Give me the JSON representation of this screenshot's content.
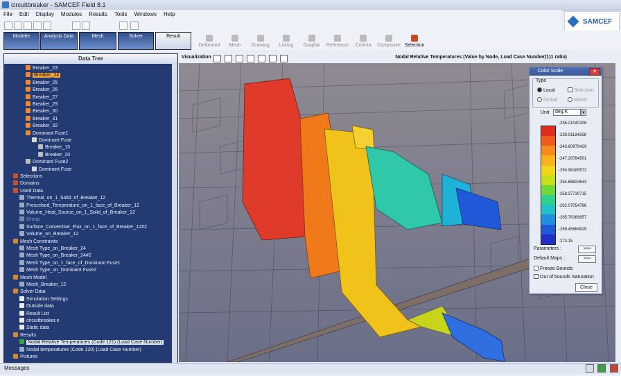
{
  "window": {
    "title": "circuitbreaker - SAMCEF Field 8.1"
  },
  "menu": [
    "File",
    "Edit",
    "Display",
    "Modules",
    "Results",
    "Tools",
    "Windows",
    "Help"
  ],
  "brand": "SAMCEF",
  "modules": [
    {
      "label": "Modeler"
    },
    {
      "label": "Analysis Data"
    },
    {
      "label": "Mesh"
    },
    {
      "label": "Solver"
    },
    {
      "label": "Result",
      "active": true
    }
  ],
  "result_tools": [
    "Deformed",
    "Mesh",
    "Drawing",
    "Listing",
    "Graphic",
    "Reference",
    "Criteria",
    "Composite",
    "Selection"
  ],
  "tree": {
    "header": "Data Tree",
    "items": [
      {
        "label": "Breaker_23",
        "indent": 3,
        "color": "#f08a2a"
      },
      {
        "label": "Breaker_24",
        "indent": 3,
        "color": "#f08a2a",
        "selected": true
      },
      {
        "label": "Breaker_25",
        "indent": 3,
        "color": "#f08a2a"
      },
      {
        "label": "Breaker_26",
        "indent": 3,
        "color": "#f08a2a"
      },
      {
        "label": "Breaker_27",
        "indent": 3,
        "color": "#f08a2a"
      },
      {
        "label": "Breaker_29",
        "indent": 3,
        "color": "#f08a2a"
      },
      {
        "label": "Breaker_30",
        "indent": 3,
        "color": "#f08a2a"
      },
      {
        "label": "Breaker_31",
        "indent": 3,
        "color": "#f08a2a"
      },
      {
        "label": "Breaker_32",
        "indent": 3,
        "color": "#f08a2a"
      },
      {
        "label": "Dominant Fuse1",
        "indent": 3,
        "color": "#f08a2a"
      },
      {
        "label": "Dominant Fuse",
        "indent": 4,
        "color": "#d8d8d8"
      },
      {
        "label": "Breaker_15",
        "indent": 5,
        "color": "#bcbcbc"
      },
      {
        "label": "Breaker_20",
        "indent": 5,
        "color": "#bcbcbc"
      },
      {
        "label": "Dominant Fuse2",
        "indent": 3,
        "color": "#bcbcbc"
      },
      {
        "label": "Dominant Fuse",
        "indent": 4,
        "color": "#d8d8d8"
      },
      {
        "label": "Selections",
        "indent": 1,
        "color": "#c8502a"
      },
      {
        "label": "Domains",
        "indent": 1,
        "color": "#c8502a"
      },
      {
        "label": "Used Data",
        "indent": 1,
        "color": "#c8502a"
      },
      {
        "label": "Thermal_on_1_Solid_of_Breaker_12",
        "indent": 2,
        "color": "#9aa9c4"
      },
      {
        "label": "Prescribed_Temperature_on_1_face_of_Breaker_12",
        "indent": 2,
        "color": "#9aa9c4"
      },
      {
        "label": "Volume_Heat_Source_on_1_Solid_of_Breaker_12",
        "indent": 2,
        "color": "#9aa9c4"
      },
      {
        "label": "Group",
        "indent": 2,
        "color": "#7a8aa8",
        "dim": true
      },
      {
        "label": "Surface_Convective_Flux_on_1_face_of_Breaker_12#2",
        "indent": 2,
        "color": "#9aa9c4"
      },
      {
        "label": "Volume_on_Breaker_12",
        "indent": 2,
        "color": "#9aa9c4"
      },
      {
        "label": "Mesh Constraints",
        "indent": 1,
        "color": "#d38a2a"
      },
      {
        "label": "Mesh Type_on_Breaker_24",
        "indent": 2,
        "color": "#9aa9c4"
      },
      {
        "label": "Mesh Type_on_Breaker_24#2",
        "indent": 2,
        "color": "#9aa9c4"
      },
      {
        "label": "Mesh Type_on_1_face_of_Dominant Fuse1",
        "indent": 2,
        "color": "#9aa9c4"
      },
      {
        "label": "Mesh Type_on_Dominant Fuse2",
        "indent": 2,
        "color": "#9aa9c4"
      },
      {
        "label": "Mesh Model",
        "indent": 1,
        "color": "#d38a2a"
      },
      {
        "label": "Mesh_Breaker_12",
        "indent": 2,
        "color": "#9aa9c4"
      },
      {
        "label": "Solver Data",
        "indent": 1,
        "color": "#d38a2a"
      },
      {
        "label": "Simulation Settings",
        "indent": 2,
        "color": "#e8e8e8"
      },
      {
        "label": "Outside data",
        "indent": 2,
        "color": "#e8e8e8"
      },
      {
        "label": "Result List",
        "indent": 2,
        "color": "#e8e8e8"
      },
      {
        "label": "circuitbreaker.e",
        "indent": 2,
        "color": "#e8e8e8"
      },
      {
        "label": "Static data",
        "indent": 2,
        "color": "#e8e8e8"
      },
      {
        "label": "Results",
        "indent": 1,
        "color": "#d38a2a"
      },
      {
        "label": "Nodal Relative Temperatures (Code 121) (Load Case Number)",
        "indent": 2,
        "color": "#3aa047",
        "result": true
      },
      {
        "label": "Nodal temperatures (Code 120) (Load Case Number)",
        "indent": 2,
        "color": "#9aa9c4"
      },
      {
        "label": "Pictures",
        "indent": 1,
        "color": "#d38a2a"
      }
    ]
  },
  "viewport": {
    "label": "Visualization",
    "title": "Nodal Relative Temperatures (Value by Node, Load Case Number(1)1 ratio)"
  },
  "color_scale": {
    "title": "Color Scale",
    "type_label": "Type",
    "options": {
      "local": "Local",
      "selection": "Selection",
      "global": "Global",
      "mixed": "Mixed"
    },
    "unit_label": "Unit",
    "unit_value": "deg.K",
    "ticks": [
      "-236.21040208",
      "-239.91184358",
      "-243.60879429",
      "-247.28784501",
      "-250.98189572",
      "-254.66824643",
      "-258.37730715",
      "-262.07054786",
      "-265.76369857",
      "-269.45684929",
      "-273.15"
    ],
    "colors": [
      "#e32d1c",
      "#f05a1a",
      "#f68a1a",
      "#f9b21a",
      "#f2d61a",
      "#c6e01a",
      "#6fd83a",
      "#2fd08a",
      "#1fc2c8",
      "#1f8fe0",
      "#1f58d8",
      "#1f2fc8"
    ],
    "parameters_label": "Parameters :",
    "default_maps_label": "Default Maps :",
    "more_label": ">>>",
    "freeze_label": "Freeze Bounds",
    "out_of_bounds_label": "Out of bounds Saturation",
    "close_label": "Close"
  },
  "status": {
    "messages_label": "Messages"
  }
}
